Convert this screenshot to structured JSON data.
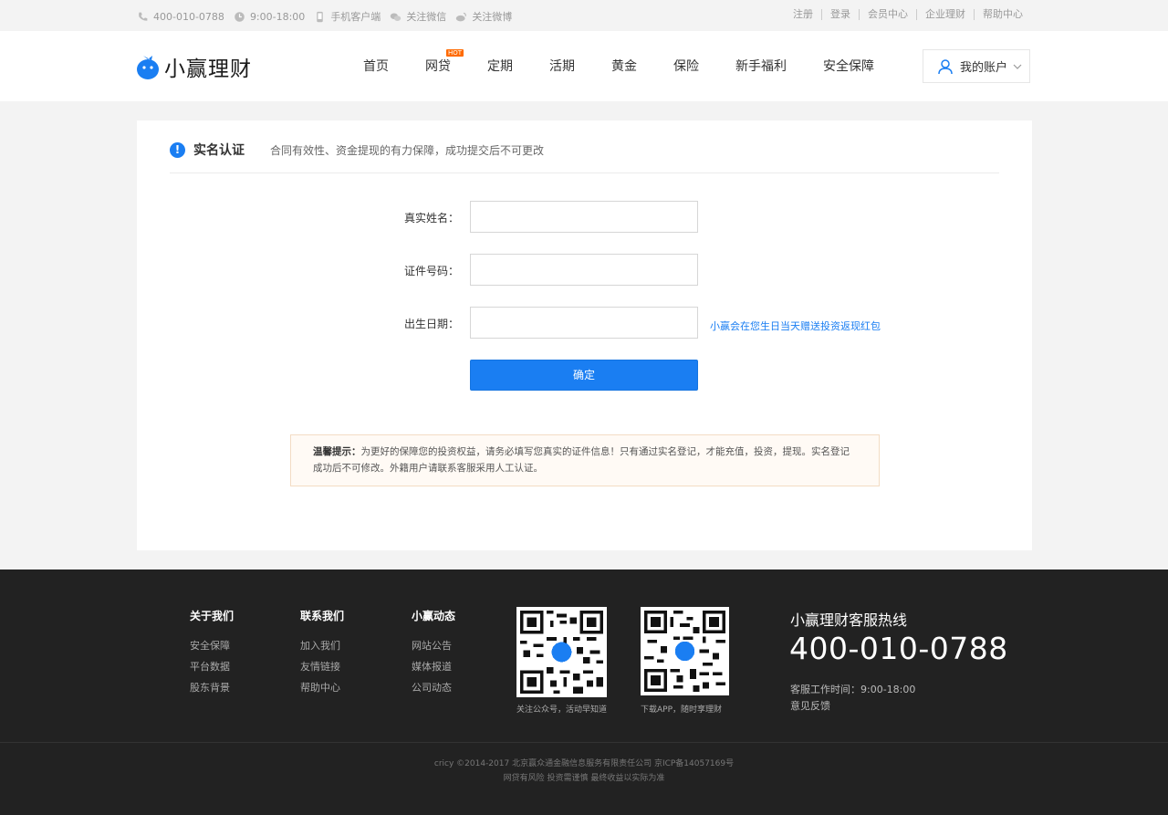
{
  "topbar": {
    "phone": "400-010-0788",
    "hours": "9:00-18:00",
    "mobile": "手机客户端",
    "wechat": "关注微信",
    "weibo": "关注微博",
    "links": [
      "注册",
      "登录",
      "会员中心",
      "企业理财",
      "帮助中心"
    ]
  },
  "header": {
    "logo_text": "小赢理财",
    "nav": [
      "首页",
      "网贷",
      "定期",
      "活期",
      "黄金",
      "保险",
      "新手福利",
      "安全保障"
    ],
    "hot_badge": "HOT",
    "account": "我的账户"
  },
  "form": {
    "title": "实名认证",
    "subtitle": "合同有效性、资金提现的有力保障，成功提交后不可更改",
    "name_label": "真实姓名：",
    "name_value": "",
    "id_label": "证件号码：",
    "id_value": "",
    "birth_label": "出生日期：",
    "birth_value": "",
    "birth_hint": "小赢会在您生日当天赠送投资返现红包",
    "submit": "确定",
    "notice_title": "温馨提示：",
    "notice_body": "为更好的保障您的投资权益，请务必填写您真实的证件信息！只有通过实名登记，才能充值，投资，提现。实名登记成功后不可修改。外籍用户请联系客服采用人工认证。"
  },
  "footer": {
    "columns": [
      {
        "title": "关于我们",
        "links": [
          "安全保障",
          "平台数据",
          "股东背景"
        ]
      },
      {
        "title": "联系我们",
        "links": [
          "加入我们",
          "友情链接",
          "帮助中心"
        ]
      },
      {
        "title": "小赢动态",
        "links": [
          "网站公告",
          "媒体报道",
          "公司动态"
        ]
      }
    ],
    "qr1_caption": "关注公众号，活动早知道",
    "qr2_caption": "下载APP，随时享理财",
    "hotline_title": "小赢理财客服热线",
    "hotline_number": "400-010-0788",
    "hotline_hours": "客服工作时间：9:00-18:00",
    "feedback": "意见反馈",
    "copyright": "cricy ©2014-2017 北京赢众通金融信息服务有限责任公司 京ICP备14057169号",
    "risk": "网贷有风险 投资需谨慎 最终收益以实际为准"
  },
  "colors": {
    "accent": "#1a7ef2",
    "footer_bg": "#222222",
    "hot": "#ff6a00"
  }
}
